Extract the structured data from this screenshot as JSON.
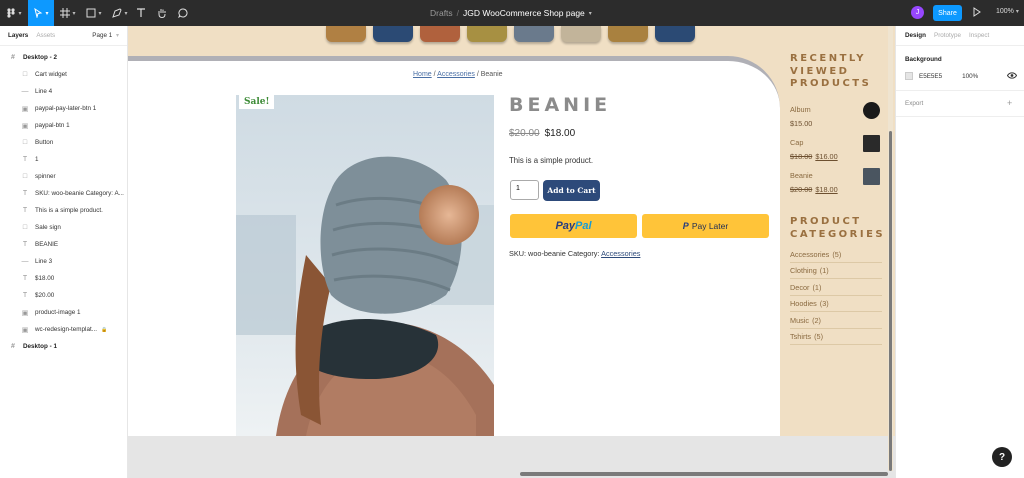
{
  "topbar": {
    "breadcrumb_drafts": "Drafts",
    "separator": "/",
    "file_name": "JGD WooCommerce Shop page",
    "avatar_initial": "J",
    "share_label": "Share",
    "zoom": "100%"
  },
  "left_panel": {
    "tab_layers": "Layers",
    "tab_assets": "Assets",
    "page": "Page 1",
    "layers": [
      {
        "label": "Desktop - 2",
        "icon": "frame-icon"
      },
      {
        "label": "Cart widget",
        "icon": "group-icon"
      },
      {
        "label": "Line 4",
        "icon": "line-icon"
      },
      {
        "label": "paypal-pay-later-btn 1",
        "icon": "image-icon"
      },
      {
        "label": "paypal-btn 1",
        "icon": "image-icon"
      },
      {
        "label": "Button",
        "icon": "group-icon"
      },
      {
        "label": "1",
        "icon": "text-icon"
      },
      {
        "label": "spinner",
        "icon": "group-icon"
      },
      {
        "label": "SKU: woo-beanie Category: A...",
        "icon": "text-icon"
      },
      {
        "label": "This is a simple product.",
        "icon": "text-icon"
      },
      {
        "label": "Sale sign",
        "icon": "group-icon"
      },
      {
        "label": "BEANIE",
        "icon": "text-icon"
      },
      {
        "label": "Line 3",
        "icon": "line-icon"
      },
      {
        "label": "$18.00",
        "icon": "text-icon"
      },
      {
        "label": "$20.00",
        "icon": "text-icon"
      },
      {
        "label": "product-image 1",
        "icon": "image-icon"
      },
      {
        "label": "wc-redesign-templat...",
        "icon": "image-icon"
      },
      {
        "label": "Desktop - 1",
        "icon": "frame-icon"
      }
    ]
  },
  "page": {
    "breadcrumb": {
      "home": "Home",
      "sep1": "/",
      "category": "Accessories",
      "sep2": "/",
      "current": "Beanie"
    },
    "sale_badge": "Sale!",
    "title": "BEANIE",
    "old_price": "$20.00",
    "price": "$18.00",
    "description": "This is a simple product.",
    "quantity": "1",
    "add_to_cart": "Add to Cart",
    "paypal_a": "Pay",
    "paypal_b": "Pal",
    "pay_later_icon": "P",
    "pay_later": "Pay Later",
    "meta_prefix": "SKU: woo-beanie Category:",
    "meta_category": "Accessories",
    "swatch_colors": [
      "#b08043",
      "#2b4a74",
      "#b0613d",
      "#a79042",
      "#6a7a8c",
      "#c2b49a",
      "#a9813f",
      "#2b4a74"
    ]
  },
  "sidebar": {
    "recently_viewed_title": [
      "RECENTLY",
      "VIEWED",
      "PRODUCTS"
    ],
    "recent": [
      {
        "name": "Album",
        "old": "",
        "price": "$15.00"
      },
      {
        "name": "Cap",
        "old": "$18.00",
        "price": "$16.00"
      },
      {
        "name": "Beanie",
        "old": "$20.00",
        "price": "$18.00"
      }
    ],
    "categories_title": [
      "PRODUCT",
      "CATEGORIES"
    ],
    "categories": [
      {
        "name": "Accessories",
        "count": "(5)"
      },
      {
        "name": "Clothing",
        "count": "(1)"
      },
      {
        "name": "Decor",
        "count": "(1)"
      },
      {
        "name": "Hoodies",
        "count": "(3)"
      },
      {
        "name": "Music",
        "count": "(2)"
      },
      {
        "name": "Tshirts",
        "count": "(5)"
      }
    ]
  },
  "right_panel": {
    "tab_design": "Design",
    "tab_prototype": "Prototype",
    "tab_inspect": "Inspect",
    "background_label": "Background",
    "bg_hex": "E5E5E5",
    "bg_opacity": "100%",
    "export_label": "Export",
    "plus": "+"
  },
  "help": "?"
}
